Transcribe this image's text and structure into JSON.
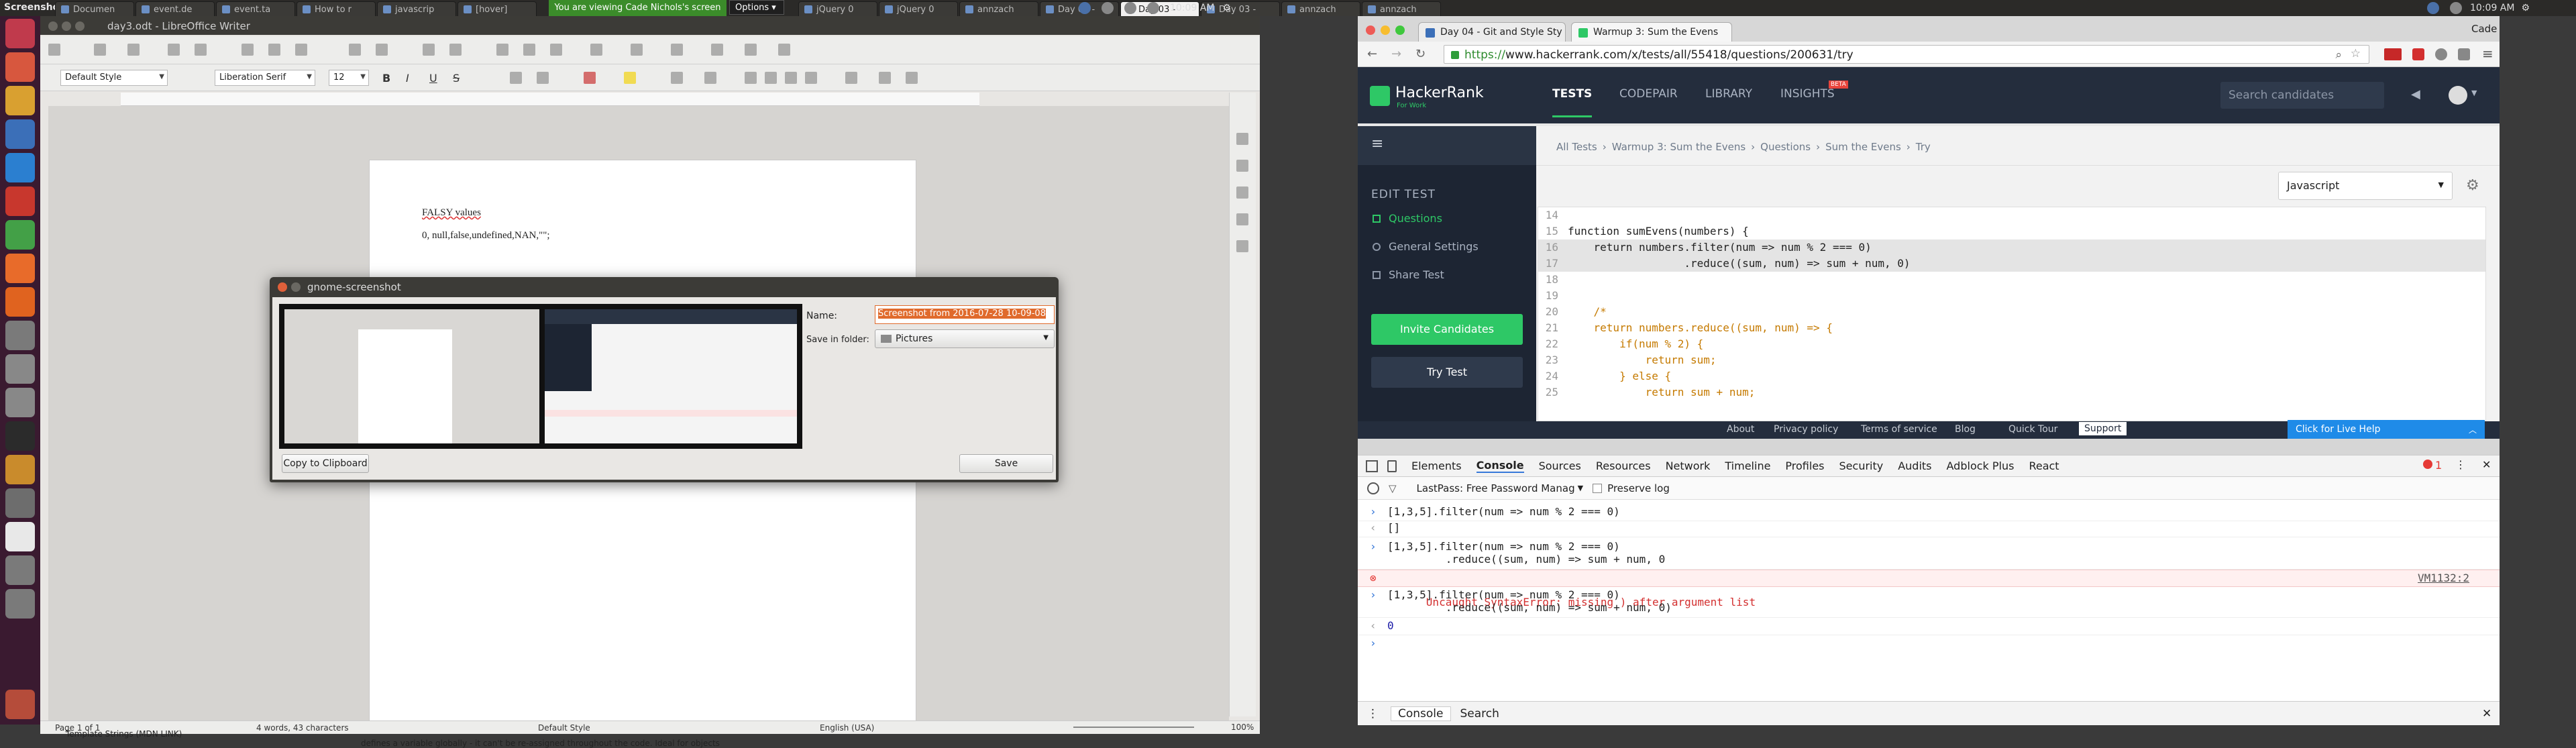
{
  "system": {
    "app_name": "Screenshot",
    "clock_left": "10:09 AM",
    "clock_right": "10:09 AM",
    "share_banner": "You are viewing Cade Nichols's screen",
    "options_label": "Options",
    "panel_tabs": [
      "Documen",
      "event.de",
      "event.ta",
      "How to r",
      "javascrip",
      "[hover]",
      "jQuery 0",
      "jQuery 0",
      "annzach",
      "Day 03 -",
      "Day 03 -",
      "Day 03 -",
      "annzach",
      "annzach"
    ]
  },
  "writer": {
    "title": "day3.odt - LibreOffice Writer",
    "style_value": "Default Style",
    "font_value": "Liberation Serif",
    "size_value": "12",
    "doc_heading": "FALSY values",
    "doc_line": "0, null,false,undefined,NAN,\"\";",
    "status_page": "Page 1 of 1",
    "status_words": "4 words, 43 characters",
    "status_style": "Default Style",
    "status_lang": "English (USA)",
    "status_zoom": "100%",
    "below_text_1": "Template Strings (MDN LINK)",
    "below_text_2": "defines a variable globally - it can't be re-assigned throughout the code. Ideal for objects"
  },
  "dialog": {
    "title": "gnome-screenshot",
    "name_label": "Name:",
    "name_value": "Screenshot from 2016-07-28 10-09-08",
    "folder_label": "Save in folder:",
    "folder_value": "Pictures",
    "copy_label": "Copy to Clipboard",
    "save_label": "Save"
  },
  "chrome": {
    "tab1": "Day 04 - Git and Style Sty",
    "tab2": "Warmup 3: Sum the Evens",
    "profile": "Cade",
    "url_scheme": "https://",
    "url_rest": "www.hackerrank.com/x/tests/all/55418/questions/200631/try"
  },
  "hackerrank": {
    "brand": "HackerRank",
    "brand_sub": "For Work",
    "nav": [
      "TESTS",
      "CODEPAIR",
      "LIBRARY",
      "INSIGHTS"
    ],
    "beta": "BETA",
    "search_placeholder": "Search candidates",
    "breadcrumb": [
      "All Tests",
      "Warmup 3: Sum the Evens",
      "Questions",
      "Sum the Evens",
      "Try"
    ],
    "side_header": "EDIT TEST",
    "side_items": [
      "Questions",
      "General Settings",
      "Share Test"
    ],
    "invite_label": "Invite Candidates",
    "try_label": "Try Test",
    "language": "Javascript",
    "footer_links": [
      "About",
      "Privacy policy",
      "Terms of service",
      "Blog",
      "Quick Tour",
      "Support"
    ],
    "live_help": "Click for Live Help"
  },
  "code_lines": [
    {
      "n": "14",
      "t": ""
    },
    {
      "n": "15",
      "t": "function sumEvens(numbers) {"
    },
    {
      "n": "16",
      "t": "    return numbers.filter(num => num % 2 === 0)"
    },
    {
      "n": "17",
      "t": "                  .reduce((sum, num) => sum + num, 0)"
    },
    {
      "n": "18",
      "t": ""
    },
    {
      "n": "19",
      "t": ""
    },
    {
      "n": "20",
      "t": "    /*"
    },
    {
      "n": "21",
      "t": "    return numbers.reduce((sum, num) => {"
    },
    {
      "n": "22",
      "t": "        if(num % 2) {"
    },
    {
      "n": "23",
      "t": "            return sum;"
    },
    {
      "n": "24",
      "t": "        } else {"
    },
    {
      "n": "25",
      "t": "            return sum + num;"
    }
  ],
  "devtools": {
    "tabs": [
      "Elements",
      "Console",
      "Sources",
      "Resources",
      "Network",
      "Timeline",
      "Profiles",
      "Security",
      "Audits",
      "Adblock Plus",
      "React"
    ],
    "context": "LastPass: Free Password Manag",
    "preserve_log": "Preserve log",
    "error_count": "1",
    "lines": [
      "[1,3,5].filter(num => num % 2 === 0)",
      "[]",
      "[1,3,5].filter(num => num % 2 === 0)",
      "         .reduce((sum, num) => sum + num, 0",
      "Uncaught SyntaxError: missing ) after argument list",
      "[1,3,5].filter(num => num % 2 === 0)",
      "         .reduce((sum, num) => sum + num, 0)",
      "0"
    ],
    "error_link": "VM1132:2",
    "drawer_tabs": [
      "Console",
      "Search"
    ]
  }
}
